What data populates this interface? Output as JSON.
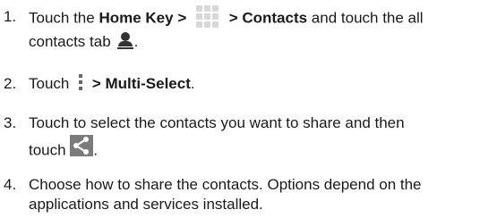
{
  "steps": [
    {
      "num": "1.",
      "p1": "Touch the ",
      "bold1": "Home Key > ",
      "bold2": " > Contacts",
      "p2": " and touch the all",
      "line2": "contacts tab",
      "line2_end": "."
    },
    {
      "num": "2.",
      "p1": "Touch ",
      "bold1": " > Multi-Select",
      "p2": "."
    },
    {
      "num": "3.",
      "line1": "Touch to select the contacts you want to share and then",
      "line2": "touch ",
      "line2_end": "."
    },
    {
      "num": "4.",
      "line1": "Choose how to share the contacts. Options depend on the",
      "line2": "applications and services installed."
    }
  ],
  "icons": {
    "apps": "grid-icon",
    "contacts_tab": "person-icon",
    "menu": "menu-icon",
    "share": "share-icon"
  }
}
